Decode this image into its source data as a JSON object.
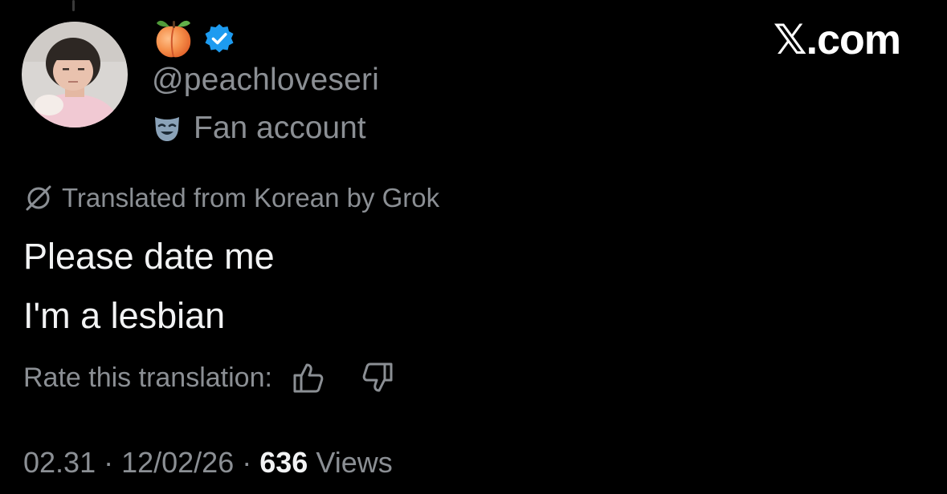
{
  "author": {
    "emoji_icon": "peach-emoji-icon",
    "verified": true,
    "verified_badge_color": "#1d9bf0",
    "handle": "@peachloveseri",
    "label_icon": "theater-mask-icon",
    "label": "Fan account"
  },
  "brand": {
    "logo_text": "𝕏.com"
  },
  "translation": {
    "icon": "translate-slash-icon",
    "note": "Translated from Korean by Grok"
  },
  "tweet": {
    "lines": [
      "Please date me",
      "I'm a lesbian"
    ]
  },
  "rating": {
    "label": "Rate this translation:",
    "up_icon": "thumbs-up-icon",
    "down_icon": "thumbs-down-icon"
  },
  "meta": {
    "time": "02.31",
    "date": "12/02/26",
    "views_count": "636",
    "views_label": "Views",
    "separator": "·"
  },
  "colors": {
    "background": "#000000",
    "primary_text": "#f2f3f4",
    "secondary_text": "#8b8f94",
    "verified_blue": "#1d9bf0"
  }
}
